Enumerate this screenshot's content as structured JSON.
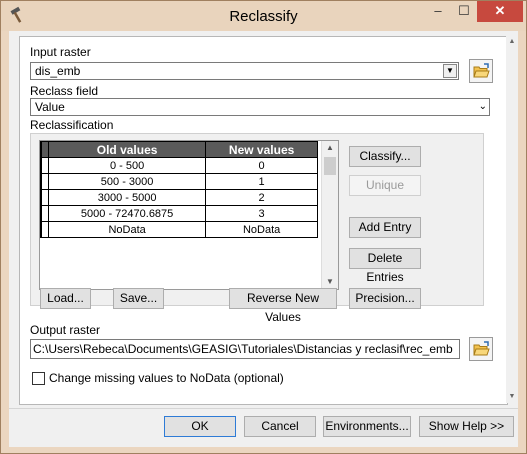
{
  "window": {
    "title": "Reclassify"
  },
  "titlebar_buttons": {
    "minimize": "–",
    "maximize": "☐",
    "close": "✕"
  },
  "input_raster": {
    "label": "Input raster",
    "value": "dis_emb"
  },
  "reclass_field": {
    "label": "Reclass field",
    "value": "Value"
  },
  "reclassification": {
    "label": "Reclassification",
    "columns": [
      "Old values",
      "New values"
    ],
    "rows": [
      {
        "old": "0 - 500",
        "new": "0"
      },
      {
        "old": "500 - 3000",
        "new": "1"
      },
      {
        "old": "3000 - 5000",
        "new": "2"
      },
      {
        "old": "5000 - 72470.6875",
        "new": "3"
      },
      {
        "old": "NoData",
        "new": "NoData"
      }
    ]
  },
  "buttons": {
    "classify": "Classify...",
    "unique": "Unique",
    "add_entry": "Add Entry",
    "delete_entries": "Delete Entries",
    "load": "Load...",
    "save": "Save...",
    "reverse": "Reverse New Values",
    "precision": "Precision..."
  },
  "output_raster": {
    "label": "Output raster",
    "value": "C:\\Users\\Rebeca\\Documents\\GEASIG\\Tutoriales\\Distancias y reclasif\\rec_emb"
  },
  "change_missing": {
    "label": "Change missing values to NoData (optional)",
    "checked": false
  },
  "footer": {
    "ok": "OK",
    "cancel": "Cancel",
    "environments": "Environments...",
    "help": "Show Help >>"
  }
}
